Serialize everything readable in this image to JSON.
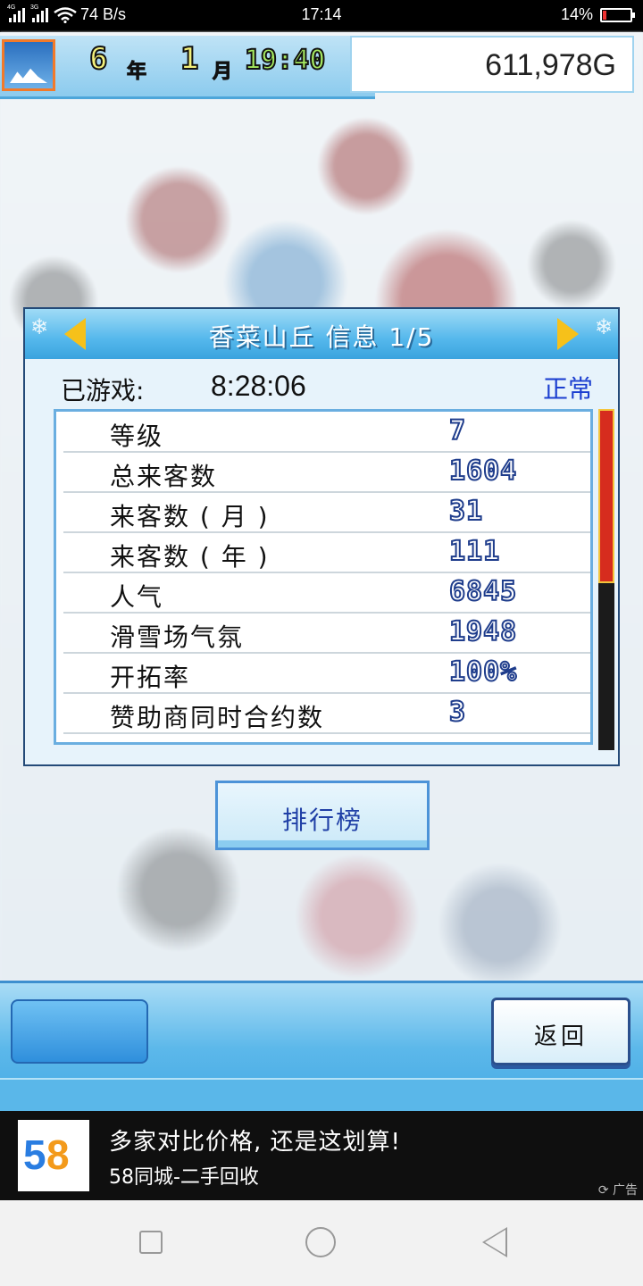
{
  "status_bar": {
    "network_left": "4G",
    "network_right": "3G",
    "speed": "74 B/s",
    "time": "17:14",
    "battery": "14%",
    "battery_level": 0.14
  },
  "hud": {
    "year_value": "6",
    "year_unit": "年",
    "month_value": "1",
    "month_unit": "月",
    "clock": "19:40",
    "money": "611,978G"
  },
  "panel": {
    "title": "香菜山丘 信息 1/5",
    "played_label": "已游戏:",
    "played_value": "8:28:06",
    "status": "正常",
    "stats": [
      {
        "label": "等级",
        "value": "7"
      },
      {
        "label": "总来客数",
        "value": "1604"
      },
      {
        "label": "来客数 ( 月 )",
        "value": "31"
      },
      {
        "label": "来客数 ( 年 )",
        "value": "111"
      },
      {
        "label": "人气",
        "value": "6845"
      },
      {
        "label": "滑雪场气氛",
        "value": "1948"
      },
      {
        "label": "开拓率",
        "value": "100%"
      },
      {
        "label": "赞助商同时合约数",
        "value": "3"
      }
    ],
    "scroll_fraction": 0.51
  },
  "ranking_button": "排行榜",
  "back_button": "返回",
  "ad": {
    "logo": "58",
    "title": "多家对比价格, 还是这划算!",
    "subtitle": "58同城-二手回收",
    "tag": "广告"
  }
}
